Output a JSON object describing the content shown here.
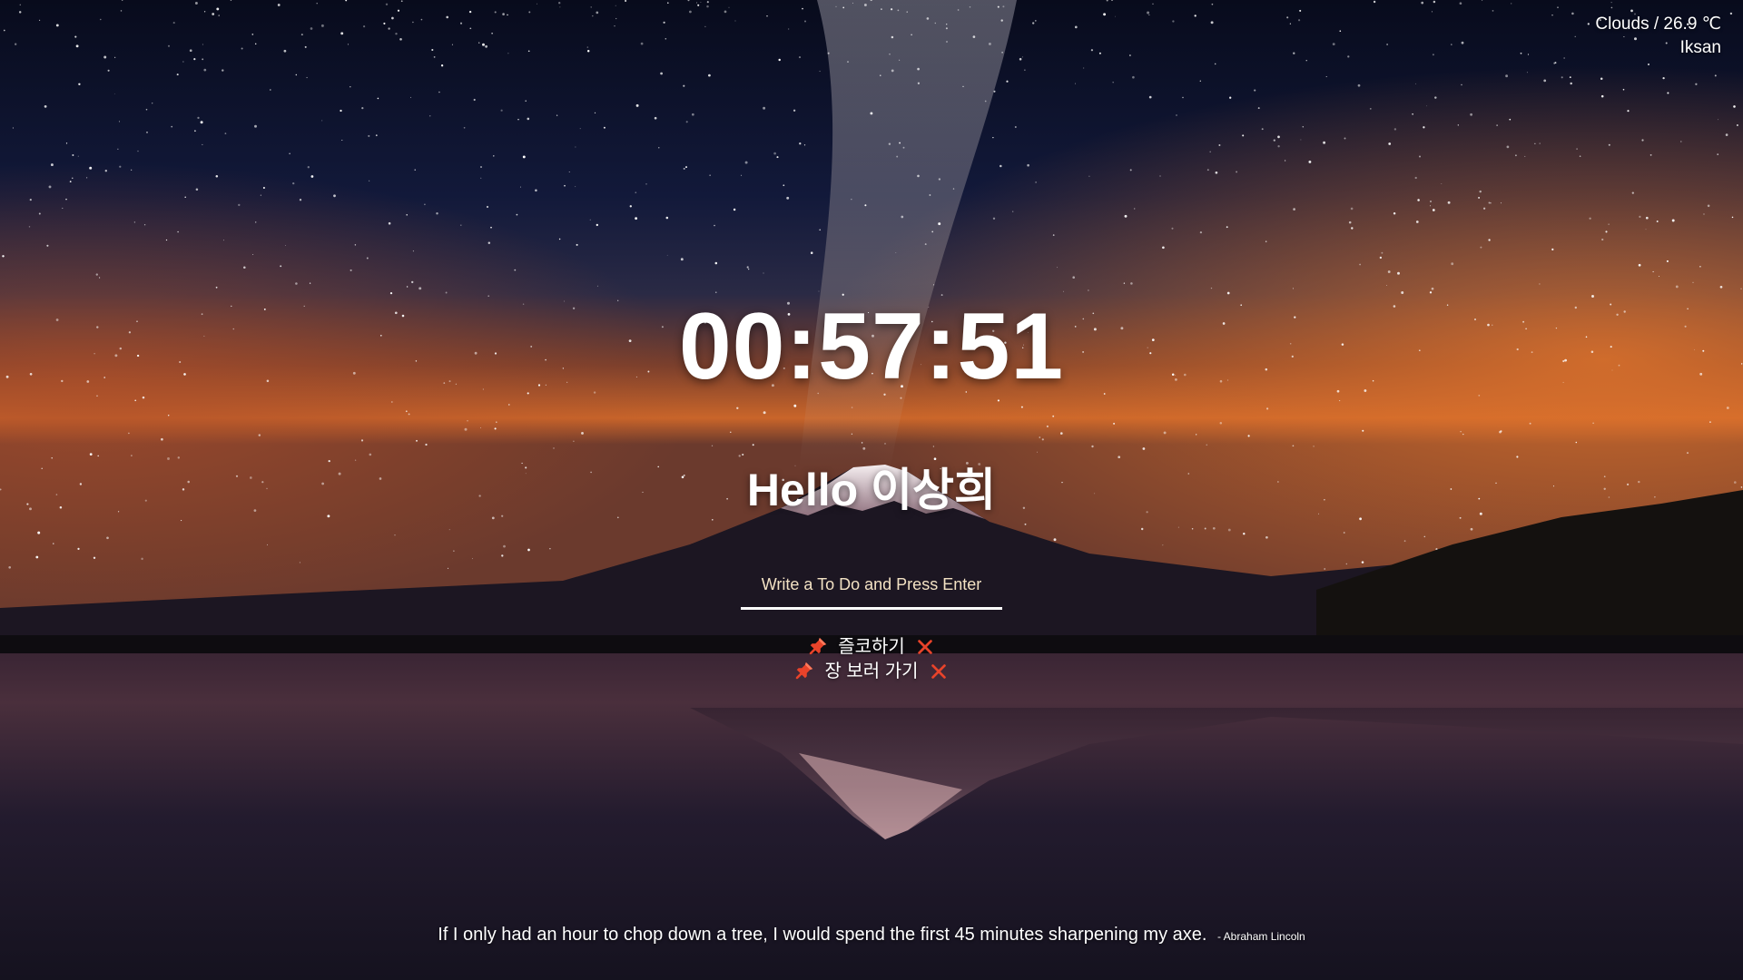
{
  "weather": {
    "condition_temp": "Clouds / 26.9 ℃",
    "city": "Iksan"
  },
  "clock": {
    "time": "00:57:51"
  },
  "greeting": {
    "text": "Hello 이상희"
  },
  "todo_form": {
    "placeholder": "Write a To Do and Press Enter",
    "value": ""
  },
  "todos": [
    {
      "text": "즐코하기",
      "icon": "pushpin-icon",
      "delete_icon": "close-icon"
    },
    {
      "text": "장 보러 가기",
      "icon": "pushpin-icon",
      "delete_icon": "close-icon"
    }
  ],
  "quote": {
    "text": "If I only had an hour to chop down a tree, I would spend the first 45 minutes sharpening my axe.",
    "author": "- Abraham Lincoln"
  },
  "colors": {
    "text": "#ffffff",
    "placeholder": "#f3e2c4",
    "pin": "#e8432a",
    "delete": "#e8432a",
    "sky_top": "#0b0f22",
    "horizon_glow": "#d8692c",
    "lake": "#1c1730"
  },
  "background": {
    "scene": "starry night sky with milky way over snow-capped mountain reflected in lake"
  }
}
